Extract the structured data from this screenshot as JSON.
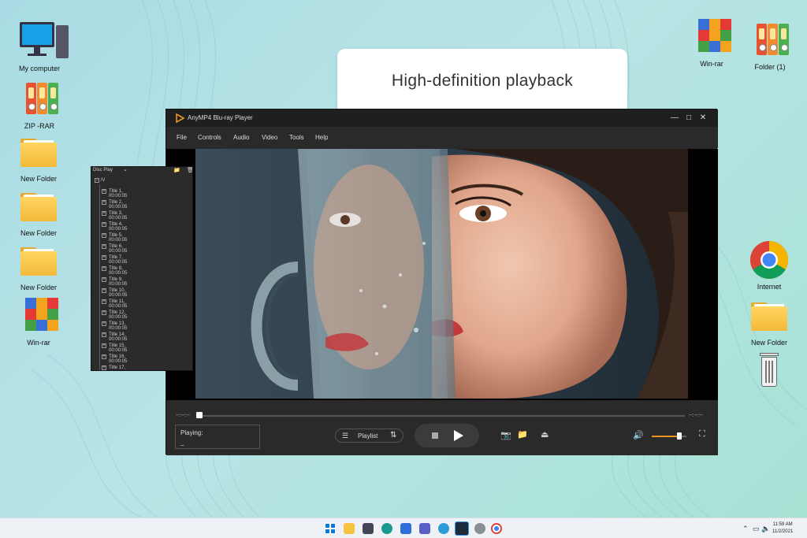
{
  "banner": {
    "text": "High-definition playback"
  },
  "desktop_icons": {
    "my_computer": "My computer",
    "zip_rar": "ZIP -RAR",
    "new_folder_1": "New Folder",
    "new_folder_2": "New Folder",
    "new_folder_3": "New Folder",
    "win_rar_left": "Win-rar",
    "win_rar_right": "Win-rar",
    "folder_1": "Folder (1)",
    "internet": "Internet",
    "new_folder_right": "New Folder",
    "recycle_bin": ""
  },
  "player": {
    "title": "AnyMP4 Blu-ray Player",
    "menu": [
      "File",
      "Controls",
      "Audio",
      "Video",
      "Tools",
      "Help"
    ],
    "time_elapsed": "--:--:--",
    "time_total": "--:--:--",
    "playing_label": "Playing:",
    "playing_value": "_",
    "playlist_label": "Playlist",
    "progress_fraction": 0.0,
    "volume_fraction": 0.75
  },
  "disc_panel": {
    "header": "Disc Play",
    "root": "/V",
    "titles": [
      "Title 1, 00:00:05",
      "Title 2, 00:00:05",
      "Title 3, 00:00:05",
      "Title 4, 00:00:05",
      "Title 5, 00:00:05",
      "Title 6, 00:00:05",
      "Title 7, 00:00:05",
      "Title 8, 00:00:05",
      "Title 9, 00:00:05",
      "Title 10, 00:00:05",
      "Title 11, 00:00:05",
      "Title 12, 00:00:05",
      "Title 13, 00:00:05",
      "Title 14, 00:00:05",
      "Title 15, 00:00:05",
      "Title 16, 00:00:05",
      "Title 17, 00:00:05"
    ]
  },
  "taskbar": {
    "time": "11:59 AM",
    "date": "11/2/2021",
    "icons": [
      "windows-start-icon",
      "file-explorer-icon",
      "camera-icon",
      "edge-icon",
      "store-icon",
      "teams-icon",
      "app-icon",
      "photos-icon",
      "blu-ray-player-icon",
      "settings-icon",
      "chrome-icon"
    ]
  },
  "colors": {
    "accent": "#f0941d",
    "player_bg": "#2a2a2a"
  }
}
